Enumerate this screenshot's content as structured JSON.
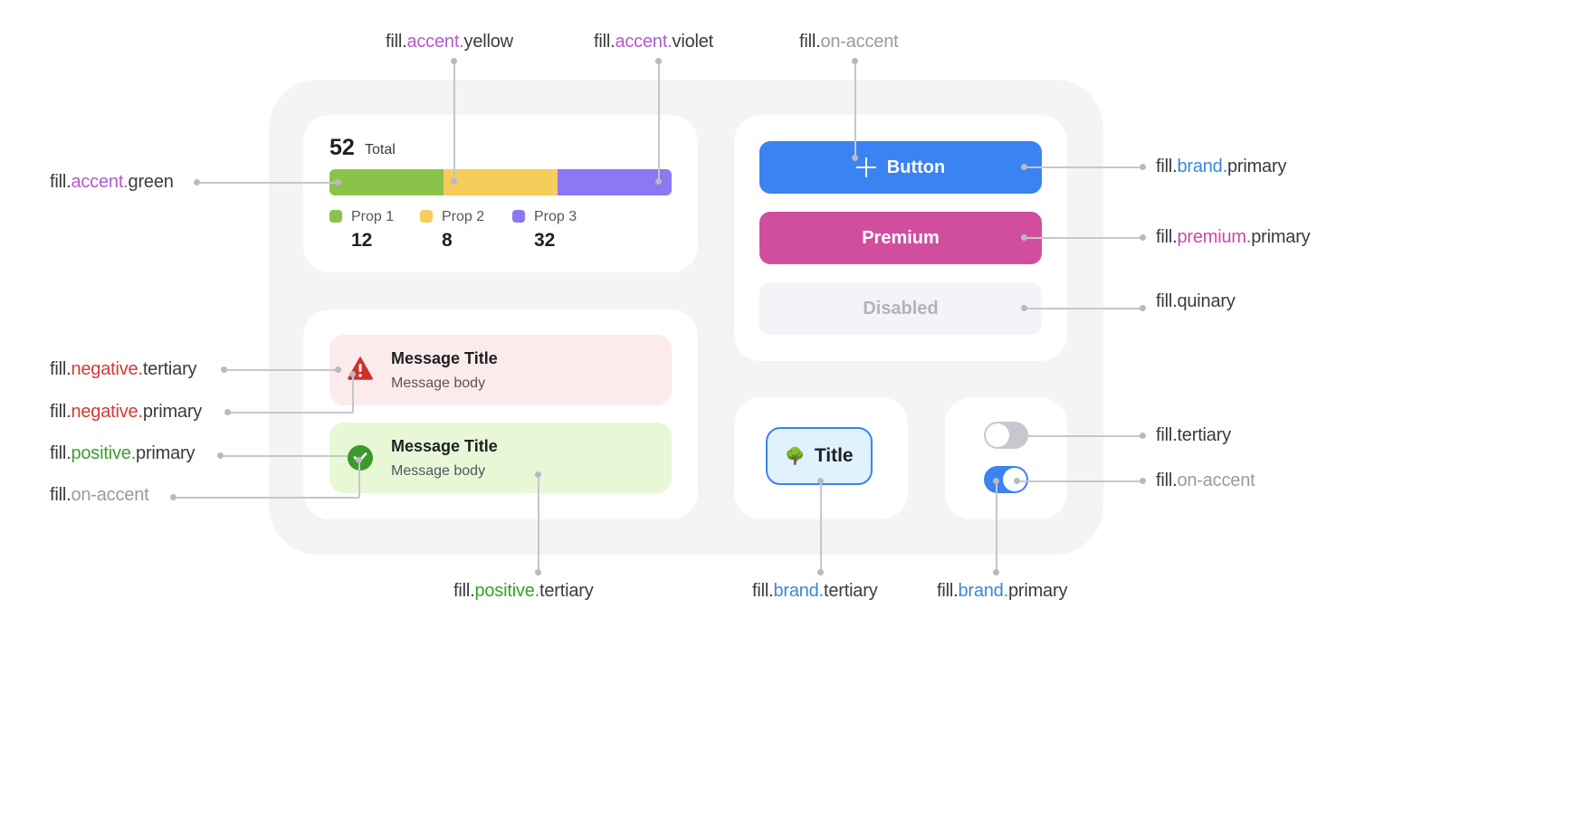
{
  "colors": {
    "accent_green": "#8bc34a",
    "accent_yellow": "#f6cc5a",
    "accent_violet": "#8b78f2",
    "brand_primary": "#3b82f2",
    "premium_primary": "#d14e9e",
    "quinary": "#f3f4f7",
    "negative_tertiary": "#fcebeb",
    "negative_primary": "#d0302c",
    "positive_tertiary": "#e8f7d6",
    "positive_primary": "#3a9a2f",
    "brand_tertiary": "#dff2fd",
    "tertiary": "#c7c8cf",
    "on_accent": "#ffffff",
    "label_accent_token": "#b05cc9",
    "label_negative_token": "#d23a35",
    "label_positive_token": "#3a9e2f",
    "label_brand_token": "#3a86d6",
    "label_premium_token": "#cc48a6",
    "label_on_accent_token": "#9a9aa2"
  },
  "stats_card": {
    "total_value": "52",
    "total_label": "Total",
    "props": [
      {
        "name": "Prop 1",
        "value": 12,
        "color_key": "accent_green"
      },
      {
        "name": "Prop 2",
        "value": 8,
        "color_key": "accent_yellow"
      },
      {
        "name": "Prop 3",
        "value": 32,
        "color_key": "accent_violet"
      }
    ],
    "bar_segments_fraction": [
      0.333,
      0.333,
      0.334
    ]
  },
  "buttons": {
    "primary_label": "Button",
    "primary_icon": "plus-icon",
    "premium_label": "Premium",
    "disabled_label": "Disabled"
  },
  "messages": [
    {
      "type": "negative",
      "icon": "warning-triangle-icon",
      "title": "Message Title",
      "body": "Message body"
    },
    {
      "type": "positive",
      "icon": "checkmark-circle-icon",
      "title": "Message Title",
      "body": "Message body"
    }
  ],
  "chip": {
    "icon": "tree-icon",
    "emoji": "🌳",
    "label": "Title"
  },
  "toggles": [
    {
      "state": "off"
    },
    {
      "state": "on"
    }
  ],
  "annotations": {
    "accent_yellow": {
      "prefix": "fill.",
      "token": "accent.",
      "suffix": "yellow"
    },
    "accent_violet": {
      "prefix": "fill.",
      "token": "accent.",
      "suffix": "violet"
    },
    "on_accent_top": {
      "prefix": "fill.",
      "token": "on-accent",
      "suffix": ""
    },
    "accent_green": {
      "prefix": "fill.",
      "token": "accent.",
      "suffix": "green"
    },
    "brand_primary_right": {
      "prefix": "fill.",
      "token": "brand.",
      "suffix": "primary"
    },
    "premium_primary": {
      "prefix": "fill.",
      "token": "premium.",
      "suffix": "primary"
    },
    "quinary": {
      "prefix": "fill.",
      "token": "",
      "suffix": "quinary"
    },
    "negative_tertiary": {
      "prefix": "fill.",
      "token": "negative.",
      "suffix": "tertiary"
    },
    "negative_primary": {
      "prefix": "fill.",
      "token": "negative.",
      "suffix": "primary"
    },
    "positive_primary": {
      "prefix": "fill.",
      "token": "positive.",
      "suffix": "primary"
    },
    "on_accent_left": {
      "prefix": "fill.",
      "token": "on-accent",
      "suffix": ""
    },
    "tertiary": {
      "prefix": "fill.",
      "token": "",
      "suffix": "tertiary"
    },
    "on_accent_right": {
      "prefix": "fill.",
      "token": "on-accent",
      "suffix": ""
    },
    "positive_tertiary": {
      "prefix": "fill.",
      "token": "positive.",
      "suffix": "tertiary"
    },
    "brand_tertiary": {
      "prefix": "fill.",
      "token": "brand.",
      "suffix": "tertiary"
    },
    "brand_primary_bottom": {
      "prefix": "fill.",
      "token": "brand.",
      "suffix": "primary"
    }
  }
}
